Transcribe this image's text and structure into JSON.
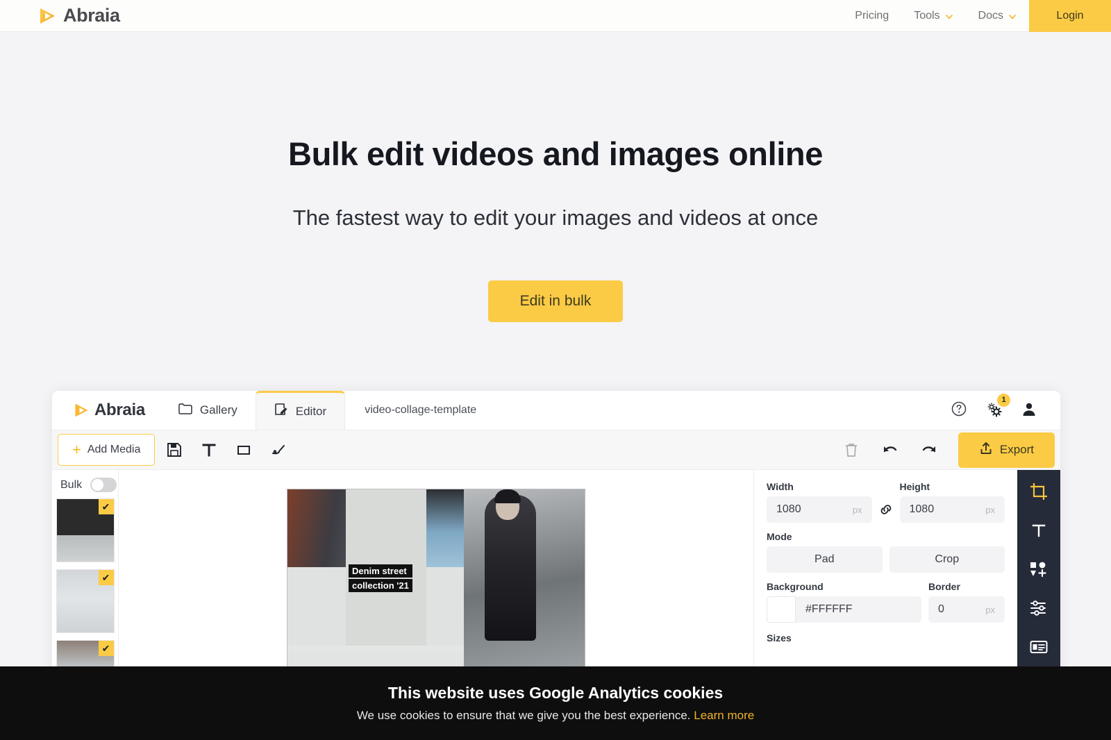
{
  "site_nav": {
    "brand": "Abraia",
    "logo_icon": "play-triangle-icon",
    "links": [
      {
        "label": "Pricing",
        "has_caret": false
      },
      {
        "label": "Tools",
        "has_caret": true
      },
      {
        "label": "Docs",
        "has_caret": true
      }
    ],
    "login_label": "Login"
  },
  "hero": {
    "title": "Bulk edit videos and images online",
    "subtitle": "The fastest way to edit your images and videos at once",
    "cta_label": "Edit in bulk"
  },
  "app": {
    "brand": "Abraia",
    "tabs": [
      {
        "label": "Gallery",
        "icon": "folder-icon",
        "active": false
      },
      {
        "label": "Editor",
        "icon": "edit-document-icon",
        "active": true
      }
    ],
    "filename": "video-collage-template",
    "header_icons": [
      {
        "name": "help-circle-icon"
      },
      {
        "name": "settings-gears-icon",
        "badge": "1"
      },
      {
        "name": "user-avatar-icon"
      }
    ],
    "toolbar": {
      "add_media_label": "Add Media",
      "add_media_icon": "plus-icon",
      "tools": [
        {
          "name": "save-floppy-icon",
          "label": "Save"
        },
        {
          "name": "text-tool-icon",
          "label": "T"
        },
        {
          "name": "shape-rectangle-icon",
          "label": "Rectangle"
        },
        {
          "name": "draw-pen-icon",
          "label": "Draw"
        }
      ],
      "right_tools": [
        {
          "name": "trash-icon",
          "label": "Delete"
        },
        {
          "name": "undo-icon",
          "label": "Undo"
        },
        {
          "name": "redo-icon",
          "label": "Redo"
        }
      ],
      "export_label": "Export",
      "export_icon": "share-upload-icon"
    },
    "left_rail": {
      "bulk_label": "Bulk",
      "bulk_toggle_on": false,
      "thumbnails": [
        {
          "name": "thumbnail-1",
          "selected": true
        },
        {
          "name": "thumbnail-2",
          "selected": true
        },
        {
          "name": "thumbnail-3",
          "selected": true
        }
      ]
    },
    "canvas": {
      "overlay_line_1": "Denim street",
      "overlay_line_2": "collection '21"
    },
    "properties": {
      "width_label": "Width",
      "width_value": "1080",
      "width_unit": "px",
      "link_icon": "link-chain-icon",
      "height_label": "Height",
      "height_value": "1080",
      "height_unit": "px",
      "mode_label": "Mode",
      "mode_options": [
        "Pad",
        "Crop"
      ],
      "background_label": "Background",
      "background_value": "#FFFFFF",
      "border_label": "Border",
      "border_value": "0",
      "border_unit": "px",
      "sizes_label": "Sizes"
    },
    "vertical_toolbar": [
      {
        "name": "crop-icon",
        "active": true
      },
      {
        "name": "text-icon",
        "active": false
      },
      {
        "name": "add-shapes-icon",
        "active": false
      },
      {
        "name": "adjustments-sliders-icon",
        "active": false
      },
      {
        "name": "layout-form-icon",
        "active": false
      }
    ]
  },
  "cookie_banner": {
    "title": "This website uses Google Analytics cookies",
    "text": "We use cookies to ensure that we give you the best experience.",
    "link_label": "Learn more"
  },
  "colors": {
    "accent": "#fbcb45",
    "page_bg": "#f4f3f5",
    "dark_panel": "#262b3a",
    "banner_bg": "#0e0e0e"
  }
}
